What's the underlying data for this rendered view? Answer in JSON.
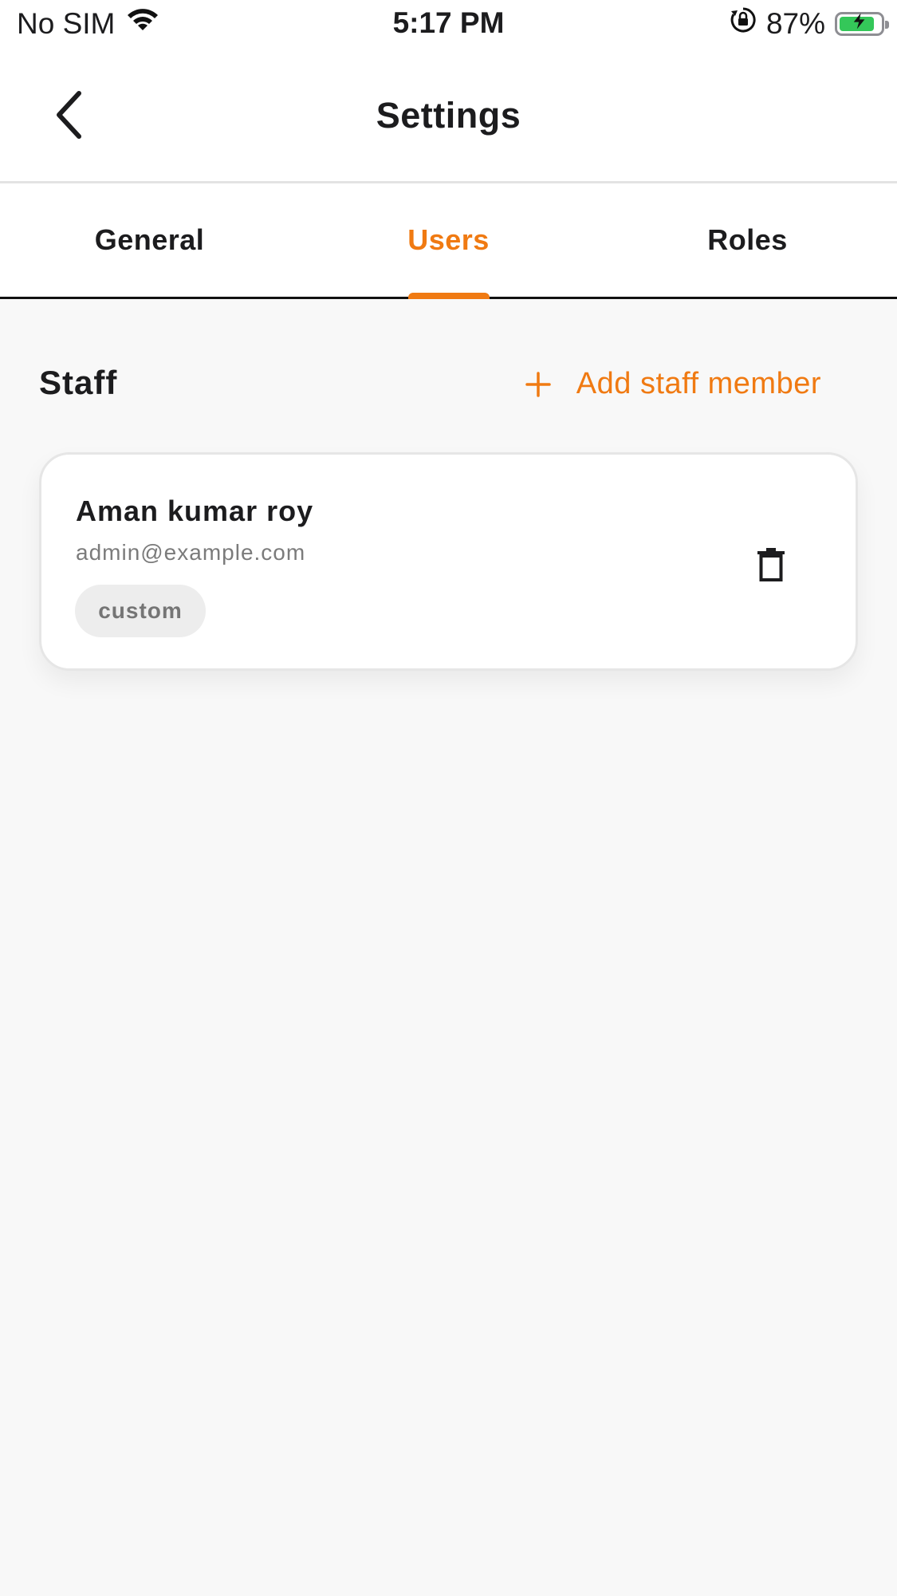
{
  "status_bar": {
    "carrier": "No SIM",
    "time": "5:17 PM",
    "battery_percent": "87%",
    "battery_level": 0.87,
    "icons": [
      "wifi-icon",
      "orientation-lock-icon",
      "battery-charging-icon"
    ]
  },
  "header": {
    "title": "Settings",
    "back_icon": "chevron-left-icon"
  },
  "tabs": [
    {
      "label": "General",
      "active": false
    },
    {
      "label": "Users",
      "active": true
    },
    {
      "label": "Roles",
      "active": false
    }
  ],
  "staff_section": {
    "title": "Staff",
    "add_button_label": "Add staff member",
    "add_icon": "plus-icon",
    "members": [
      {
        "name": "Aman kumar roy",
        "email": "admin@example.com",
        "role": "custom",
        "delete_icon": "trash-icon"
      }
    ]
  },
  "colors": {
    "accent": "#f07a12",
    "background": "#f8f8f8",
    "surface": "#ffffff",
    "text": "#1c1c1e",
    "muted_text": "#7b7b7b",
    "battery_green": "#34c759"
  }
}
